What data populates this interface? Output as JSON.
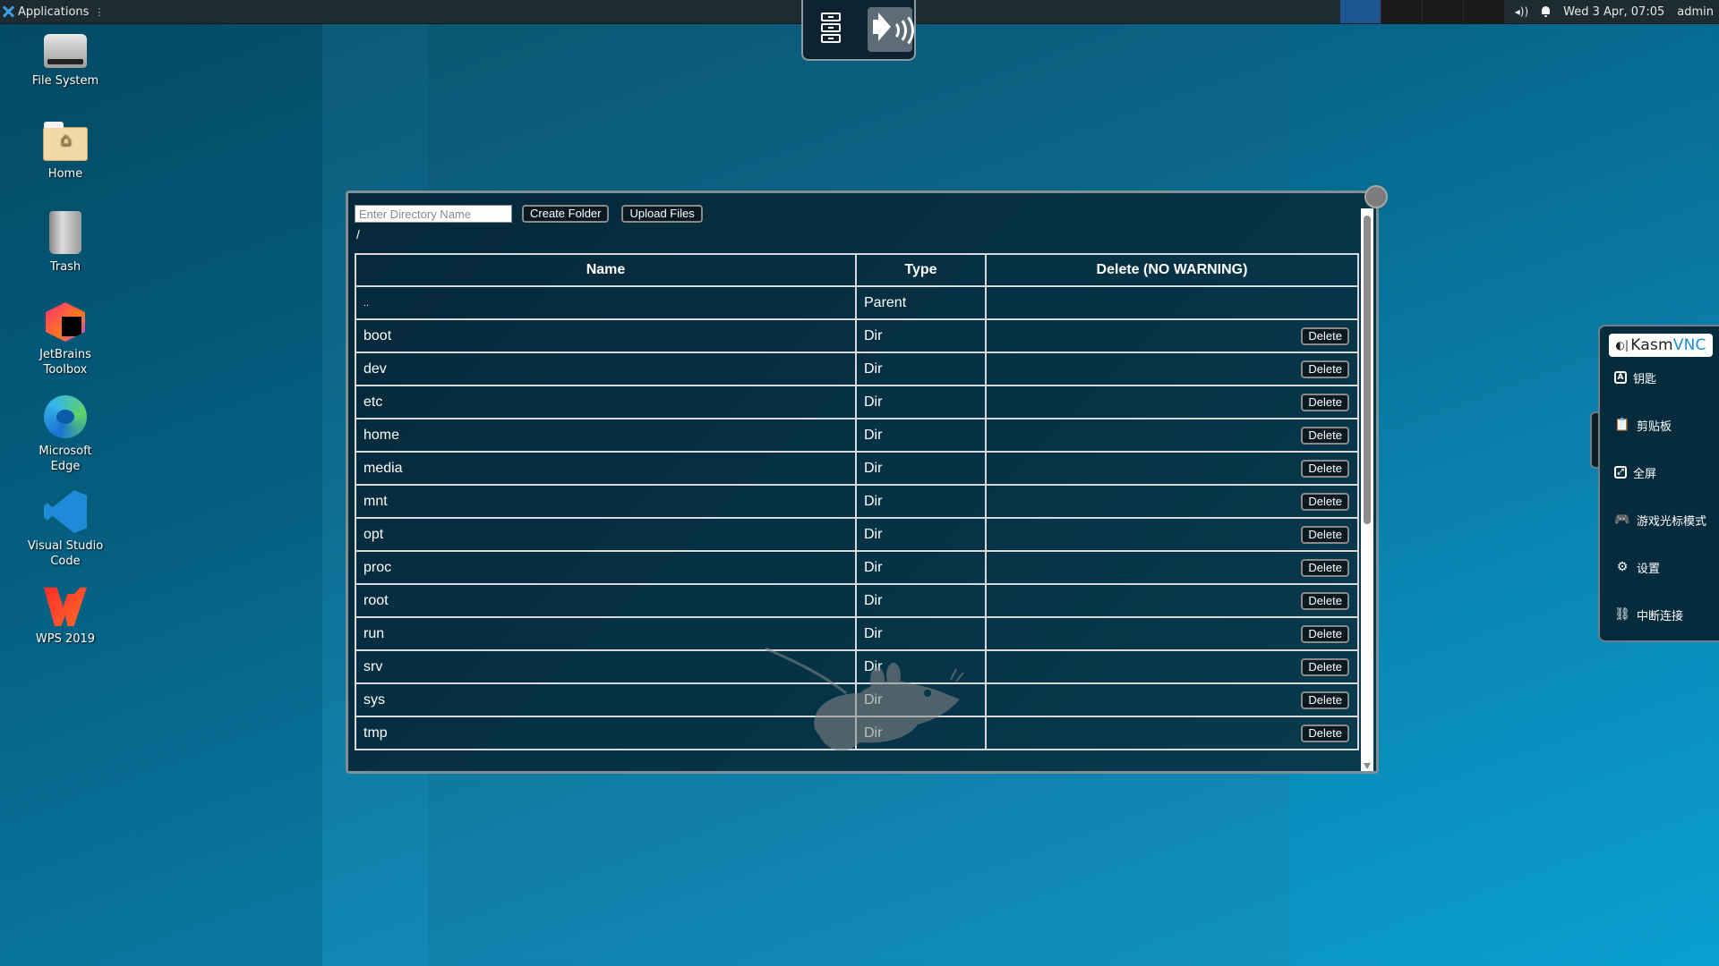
{
  "top_panel": {
    "applications_label": "Applications",
    "menu_glyph": "⋮",
    "workspaces": [
      {
        "index": 1,
        "active": true
      },
      {
        "index": 2,
        "active": false
      },
      {
        "index": 3,
        "active": false
      },
      {
        "index": 4,
        "active": false
      }
    ],
    "volume_glyph": "◂))",
    "clock": "Wed  3 Apr, 07:05",
    "user": "admin"
  },
  "desktop_icons": [
    {
      "label": "File System",
      "icon": "drive-harddisk-icon"
    },
    {
      "label": "Home",
      "icon": "home-folder-icon"
    },
    {
      "label": "Trash",
      "icon": "trash-icon"
    },
    {
      "label": "JetBrains Toolbox",
      "icon": "jetbrains-toolbox-icon"
    },
    {
      "label": "Microsoft Edge",
      "icon": "edge-icon"
    },
    {
      "label": "Visual Studio Code",
      "icon": "vscode-icon"
    },
    {
      "label": "WPS 2019",
      "icon": "wps-icon"
    }
  ],
  "vnc_float": {
    "buttons": [
      "file-cabinet-icon",
      "speaker-icon"
    ]
  },
  "file_manager": {
    "dir_input": {
      "value": "",
      "placeholder": "Enter Directory Name"
    },
    "create_folder_label": "Create Folder",
    "upload_files_label": "Upload Files",
    "current_path": "/",
    "columns": [
      "Name",
      "Type",
      "Delete (NO WARNING)"
    ],
    "delete_label": "Delete",
    "rows": [
      {
        "name": "..",
        "type": "Parent",
        "deletable": false
      },
      {
        "name": "boot",
        "type": "Dir",
        "deletable": true
      },
      {
        "name": "dev",
        "type": "Dir",
        "deletable": true
      },
      {
        "name": "etc",
        "type": "Dir",
        "deletable": true
      },
      {
        "name": "home",
        "type": "Dir",
        "deletable": true
      },
      {
        "name": "media",
        "type": "Dir",
        "deletable": true
      },
      {
        "name": "mnt",
        "type": "Dir",
        "deletable": true
      },
      {
        "name": "opt",
        "type": "Dir",
        "deletable": true
      },
      {
        "name": "proc",
        "type": "Dir",
        "deletable": true
      },
      {
        "name": "root",
        "type": "Dir",
        "deletable": true
      },
      {
        "name": "run",
        "type": "Dir",
        "deletable": true
      },
      {
        "name": "srv",
        "type": "Dir",
        "deletable": true
      },
      {
        "name": "sys",
        "type": "Dir",
        "deletable": true
      },
      {
        "name": "tmp",
        "type": "Dir",
        "deletable": true
      }
    ]
  },
  "kasm_panel": {
    "logo_prefix": "Kasm",
    "logo_suffix": "VNC",
    "items": [
      {
        "label": "钥匙",
        "icon": "keyboard-key-icon"
      },
      {
        "label": "剪贴板",
        "icon": "clipboard-icon"
      },
      {
        "label": "全屏",
        "icon": "fullscreen-icon"
      },
      {
        "label": "游戏光标模式",
        "icon": "gamepad-icon"
      },
      {
        "label": "设置",
        "icon": "gear-icon"
      },
      {
        "label": "中断连接",
        "icon": "disconnect-icon"
      }
    ]
  }
}
